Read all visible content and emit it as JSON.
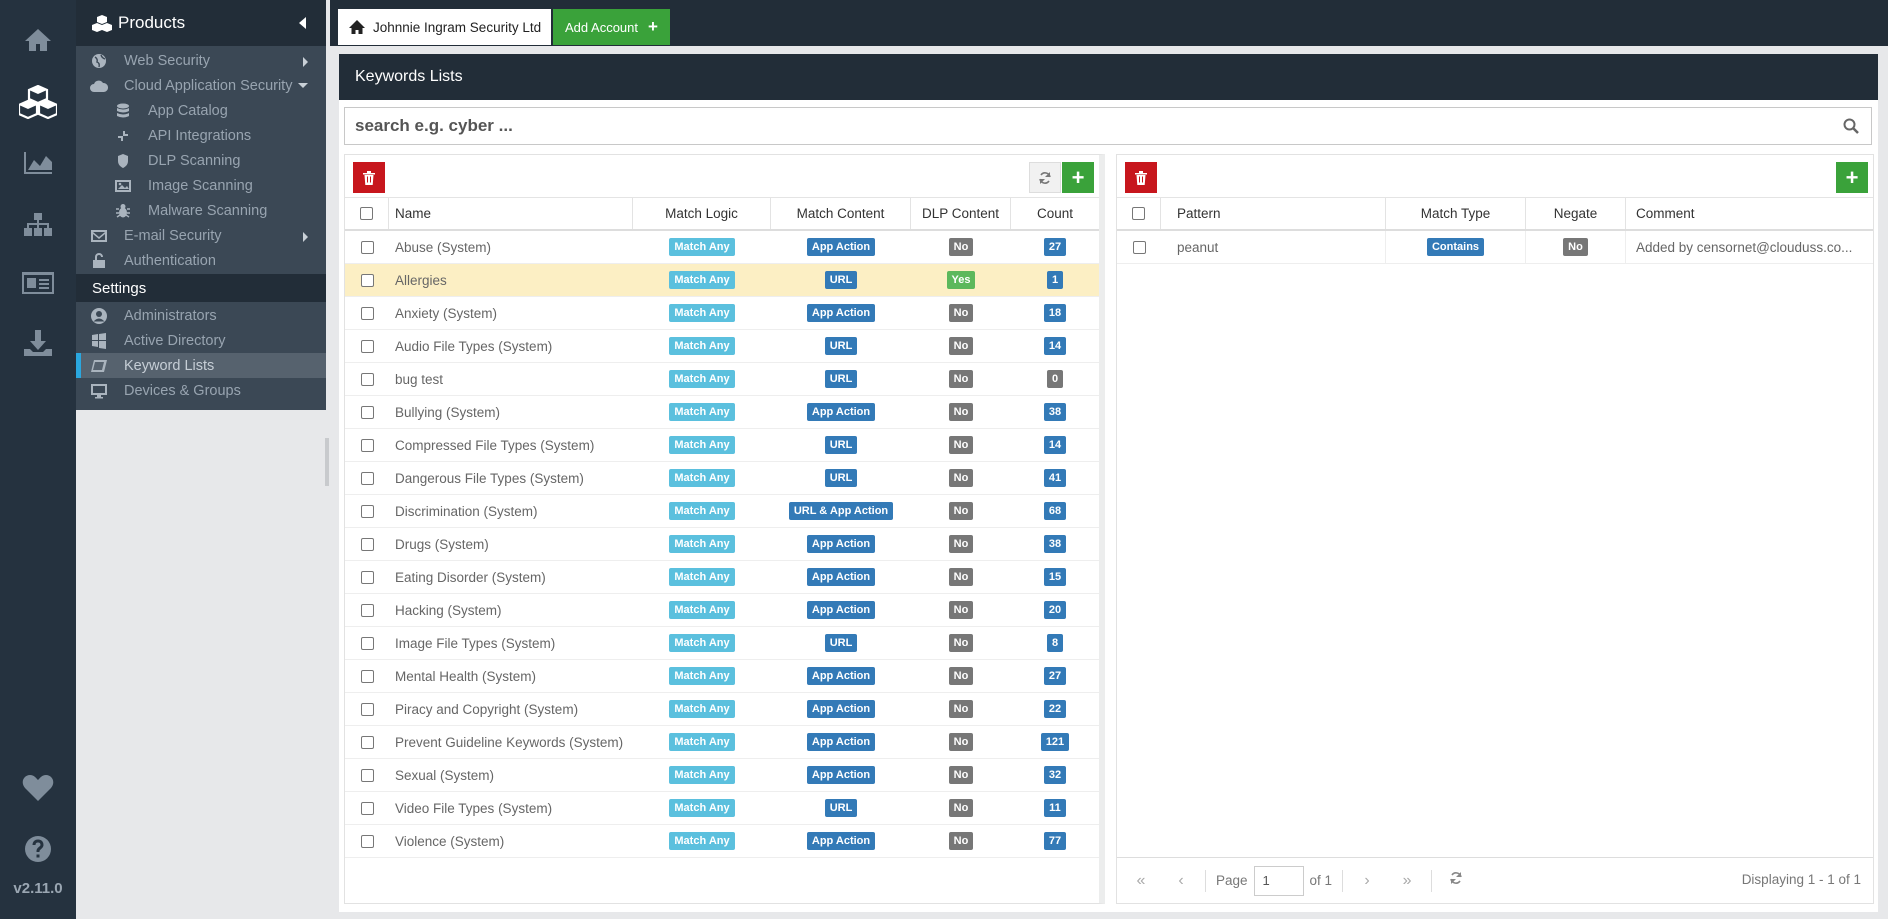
{
  "rail": {
    "icons": [
      "home-icon",
      "cubes-icon",
      "chart-icon",
      "sitemap-icon",
      "id-card-icon",
      "download-icon",
      "heart-icon",
      "help-icon"
    ],
    "version": "v2.11.0"
  },
  "sidebar": {
    "products_label": "Products",
    "items": [
      {
        "label": "Web Security",
        "icon": "globe-icon"
      },
      {
        "label": "Cloud Application Security",
        "icon": "cloud-icon"
      },
      {
        "label": "App Catalog",
        "icon": "database-icon"
      },
      {
        "label": "API Integrations",
        "icon": "compress-icon"
      },
      {
        "label": "DLP Scanning",
        "icon": "shield-icon"
      },
      {
        "label": "Image Scanning",
        "icon": "image-icon"
      },
      {
        "label": "Malware Scanning",
        "icon": "bug-icon"
      },
      {
        "label": "E-mail Security",
        "icon": "envelope-icon"
      },
      {
        "label": "Authentication",
        "icon": "lock-icon"
      }
    ],
    "settings_label": "Settings",
    "settings_items": [
      {
        "label": "Administrators",
        "icon": "user-icon"
      },
      {
        "label": "Active Directory",
        "icon": "windows-icon"
      },
      {
        "label": "Keyword Lists",
        "icon": "book-icon",
        "active": true
      },
      {
        "label": "Devices & Groups",
        "icon": "desktop-icon"
      }
    ]
  },
  "topbar": {
    "account_tab": "Johnnie Ingram Security Ltd",
    "add_account": "Add Account"
  },
  "panel": {
    "title": "Keywords Lists",
    "search_placeholder": "search e.g. cyber ..."
  },
  "left_grid": {
    "headers": {
      "name": "Name",
      "logic": "Match Logic",
      "content": "Match Content",
      "dlp": "DLP Content",
      "count": "Count"
    },
    "rows": [
      {
        "name": "Abuse (System)",
        "logic": "Match Any",
        "content": "App Action",
        "dlp": "No",
        "count": "27"
      },
      {
        "name": "Allergies",
        "logic": "Match Any",
        "content": "URL",
        "dlp": "Yes",
        "count": "1",
        "selected": true
      },
      {
        "name": "Anxiety (System)",
        "logic": "Match Any",
        "content": "App Action",
        "dlp": "No",
        "count": "18"
      },
      {
        "name": "Audio File Types (System)",
        "logic": "Match Any",
        "content": "URL",
        "dlp": "No",
        "count": "14"
      },
      {
        "name": "bug test",
        "logic": "Match Any",
        "content": "URL",
        "dlp": "No",
        "count": "0"
      },
      {
        "name": "Bullying (System)",
        "logic": "Match Any",
        "content": "App Action",
        "dlp": "No",
        "count": "38"
      },
      {
        "name": "Compressed File Types (System)",
        "logic": "Match Any",
        "content": "URL",
        "dlp": "No",
        "count": "14"
      },
      {
        "name": "Dangerous File Types (System)",
        "logic": "Match Any",
        "content": "URL",
        "dlp": "No",
        "count": "41"
      },
      {
        "name": "Discrimination (System)",
        "logic": "Match Any",
        "content": "URL & App Action",
        "dlp": "No",
        "count": "68"
      },
      {
        "name": "Drugs (System)",
        "logic": "Match Any",
        "content": "App Action",
        "dlp": "No",
        "count": "38"
      },
      {
        "name": "Eating Disorder (System)",
        "logic": "Match Any",
        "content": "App Action",
        "dlp": "No",
        "count": "15"
      },
      {
        "name": "Hacking (System)",
        "logic": "Match Any",
        "content": "App Action",
        "dlp": "No",
        "count": "20"
      },
      {
        "name": "Image File Types (System)",
        "logic": "Match Any",
        "content": "URL",
        "dlp": "No",
        "count": "8"
      },
      {
        "name": "Mental Health (System)",
        "logic": "Match Any",
        "content": "App Action",
        "dlp": "No",
        "count": "27"
      },
      {
        "name": "Piracy and Copyright (System)",
        "logic": "Match Any",
        "content": "App Action",
        "dlp": "No",
        "count": "22"
      },
      {
        "name": "Prevent Guideline Keywords (System)",
        "logic": "Match Any",
        "content": "App Action",
        "dlp": "No",
        "count": "121"
      },
      {
        "name": "Sexual (System)",
        "logic": "Match Any",
        "content": "App Action",
        "dlp": "No",
        "count": "32"
      },
      {
        "name": "Video File Types (System)",
        "logic": "Match Any",
        "content": "URL",
        "dlp": "No",
        "count": "11"
      },
      {
        "name": "Violence (System)",
        "logic": "Match Any",
        "content": "App Action",
        "dlp": "No",
        "count": "77"
      }
    ]
  },
  "right_grid": {
    "headers": {
      "pattern": "Pattern",
      "type": "Match Type",
      "negate": "Negate",
      "comment": "Comment"
    },
    "rows": [
      {
        "pattern": "peanut",
        "type": "Contains",
        "negate": "No",
        "comment": "Added by censornet@clouduss.co..."
      }
    ],
    "pager": {
      "page_label": "Page",
      "page": "1",
      "of": "of 1",
      "display": "Displaying 1 - 1 of 1"
    }
  }
}
